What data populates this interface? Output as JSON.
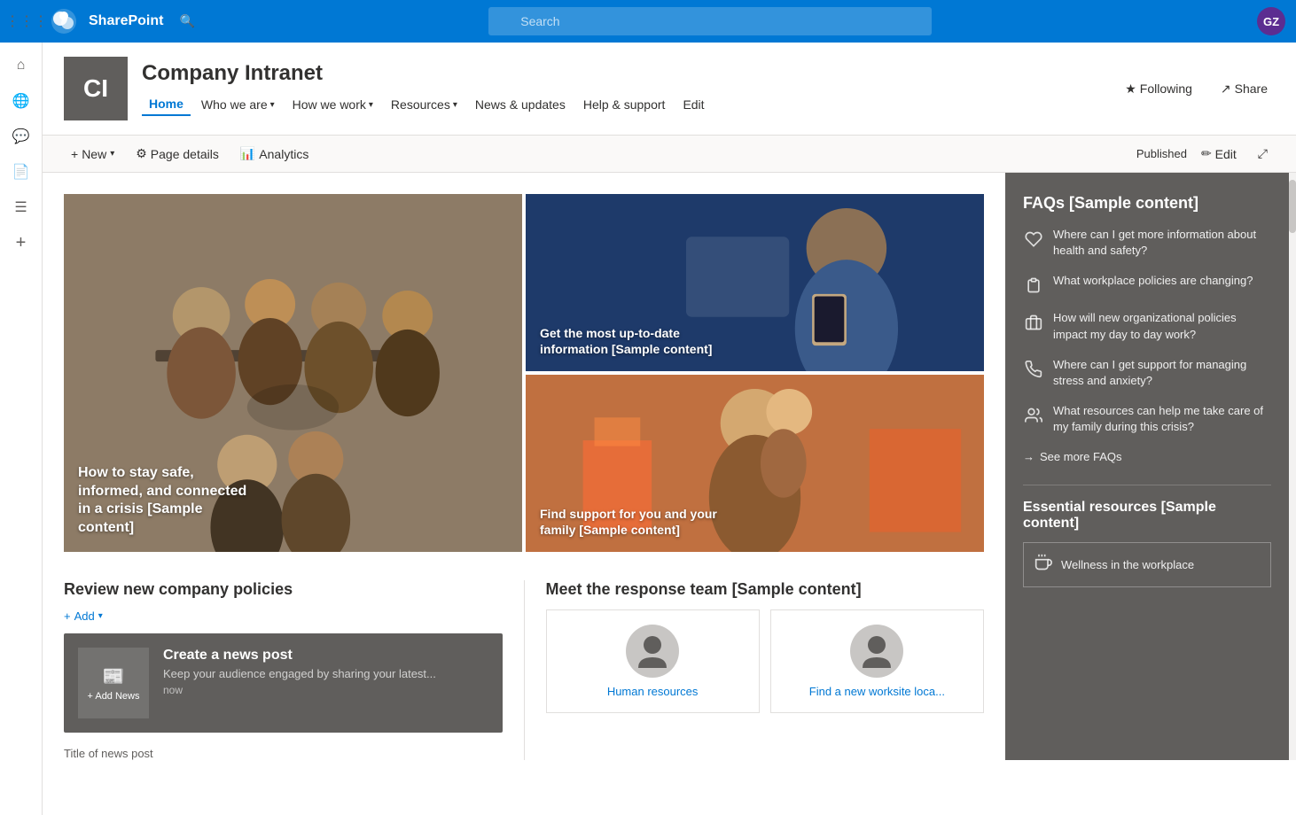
{
  "app": {
    "name": "SharePoint",
    "avatar": "GZ"
  },
  "search": {
    "placeholder": "Search"
  },
  "site": {
    "logo_text": "CI",
    "title": "Company Intranet",
    "nav": [
      {
        "label": "Home",
        "active": true,
        "has_dropdown": false
      },
      {
        "label": "Who we are",
        "active": false,
        "has_dropdown": true
      },
      {
        "label": "How we work",
        "active": false,
        "has_dropdown": true
      },
      {
        "label": "Resources",
        "active": false,
        "has_dropdown": true
      },
      {
        "label": "News & updates",
        "active": false,
        "has_dropdown": false
      },
      {
        "label": "Help & support",
        "active": false,
        "has_dropdown": false
      },
      {
        "label": "Edit",
        "active": false,
        "has_dropdown": false
      }
    ],
    "following_label": "Following",
    "share_label": "Share"
  },
  "toolbar": {
    "new_label": "New",
    "page_details_label": "Page details",
    "analytics_label": "Analytics",
    "published_label": "Published",
    "edit_label": "Edit"
  },
  "hero": {
    "items": [
      {
        "id": "hero-left",
        "label": "How to stay safe, informed, and connected in a crisis [Sample content]",
        "bg": "people"
      },
      {
        "id": "hero-top-right",
        "label": "Get the most up-to-date information [Sample content]",
        "bg": "blue"
      },
      {
        "id": "hero-bottom-right",
        "label": "Find support for you and your family [Sample content]",
        "bg": "warm"
      }
    ]
  },
  "news_section": {
    "title": "Review new company policies",
    "add_label": "Add",
    "card": {
      "title": "Create a news post",
      "description": "Keep your audience engaged by sharing your latest...",
      "time": "now",
      "add_news_label": "+ Add News"
    },
    "post_title": "Title of news post"
  },
  "response_team": {
    "title": "Meet the response team [Sample content]",
    "members": [
      {
        "name": "Human resources"
      },
      {
        "name": "Find a new worksite loca..."
      }
    ]
  },
  "faqs": {
    "title": "FAQs [Sample content]",
    "items": [
      {
        "icon": "❤",
        "text": "Where can I get more information about health and safety?"
      },
      {
        "icon": "📋",
        "text": "What workplace policies are changing?"
      },
      {
        "icon": "💼",
        "text": "How will new organizational policies impact my day to day work?"
      },
      {
        "icon": "📞",
        "text": "Where can I get support for managing stress and anxiety?"
      },
      {
        "icon": "👥",
        "text": "What resources can help me take care of my family during this crisis?"
      }
    ],
    "see_more": "See more FAQs"
  },
  "essential_resources": {
    "title": "Essential resources [Sample content]",
    "items": [
      {
        "icon": "☕",
        "text": "Wellness in the workplace"
      }
    ]
  },
  "sidebar_icons": [
    {
      "name": "home-icon",
      "symbol": "⌂"
    },
    {
      "name": "globe-icon",
      "symbol": "🌐"
    },
    {
      "name": "chat-icon",
      "symbol": "💬"
    },
    {
      "name": "document-icon",
      "symbol": "📄"
    },
    {
      "name": "list-icon",
      "symbol": "☰"
    },
    {
      "name": "add-circle-icon",
      "symbol": "+"
    }
  ]
}
